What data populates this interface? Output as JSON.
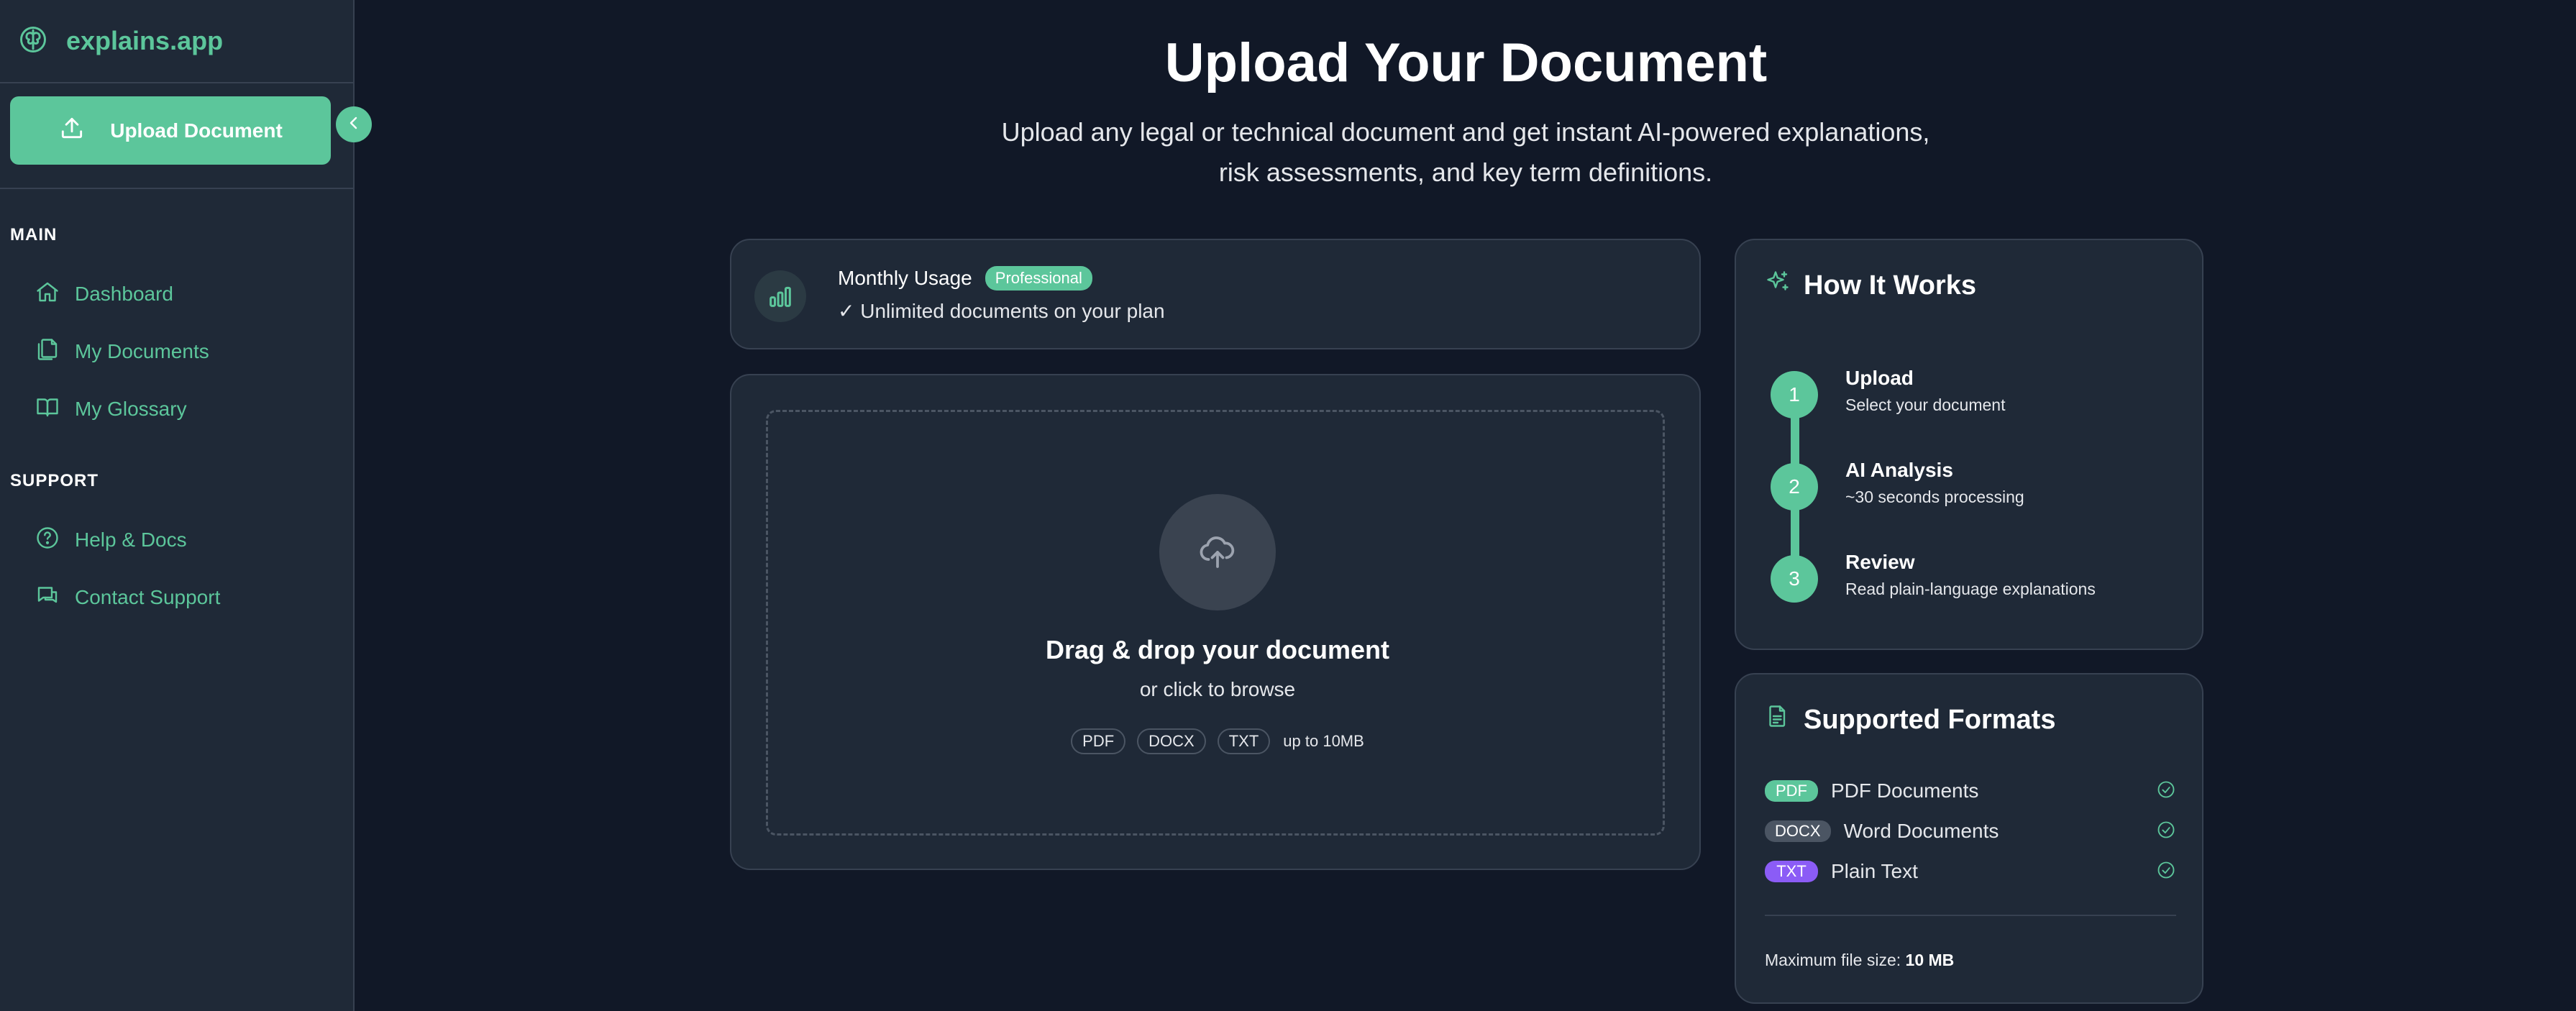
{
  "brand": {
    "name": "explains.app"
  },
  "sidebar": {
    "upload_label": "Upload Document",
    "sections": [
      {
        "title": "MAIN",
        "items": [
          {
            "label": "Dashboard",
            "icon": "home-icon"
          },
          {
            "label": "My Documents",
            "icon": "documents-icon"
          },
          {
            "label": "My Glossary",
            "icon": "book-icon"
          }
        ]
      },
      {
        "title": "SUPPORT",
        "items": [
          {
            "label": "Help & Docs",
            "icon": "help-icon"
          },
          {
            "label": "Contact Support",
            "icon": "chat-icon"
          }
        ]
      }
    ]
  },
  "header": {
    "title": "Upload Your Document",
    "subtitle_line1": "Upload any legal or technical document and get instant AI-powered explanations,",
    "subtitle_line2": "risk assessments, and key term definitions."
  },
  "usage": {
    "title": "Monthly Usage",
    "plan_badge": "Professional",
    "line": "✓ Unlimited documents on your plan"
  },
  "dropzone": {
    "title": "Drag & drop your document",
    "subtitle": "or click to browse",
    "formats": [
      "PDF",
      "DOCX",
      "TXT"
    ],
    "limit": "up to 10MB"
  },
  "how_it_works": {
    "title": "How It Works",
    "steps": [
      {
        "num": "1",
        "title": "Upload",
        "desc": "Select your document"
      },
      {
        "num": "2",
        "title": "AI Analysis",
        "desc": "~30 seconds processing"
      },
      {
        "num": "3",
        "title": "Review",
        "desc": "Read plain-language explanations"
      }
    ]
  },
  "supported": {
    "title": "Supported Formats",
    "items": [
      {
        "tag": "PDF",
        "name": "PDF Documents"
      },
      {
        "tag": "DOCX",
        "name": "Word Documents"
      },
      {
        "tag": "TXT",
        "name": "Plain Text"
      }
    ],
    "max_label": "Maximum file size:",
    "max_value": "10 MB"
  },
  "colors": {
    "accent": "#5cc69b",
    "background": "#111827",
    "panel": "#1f2937",
    "txt_tag": "#8b5cf6"
  }
}
